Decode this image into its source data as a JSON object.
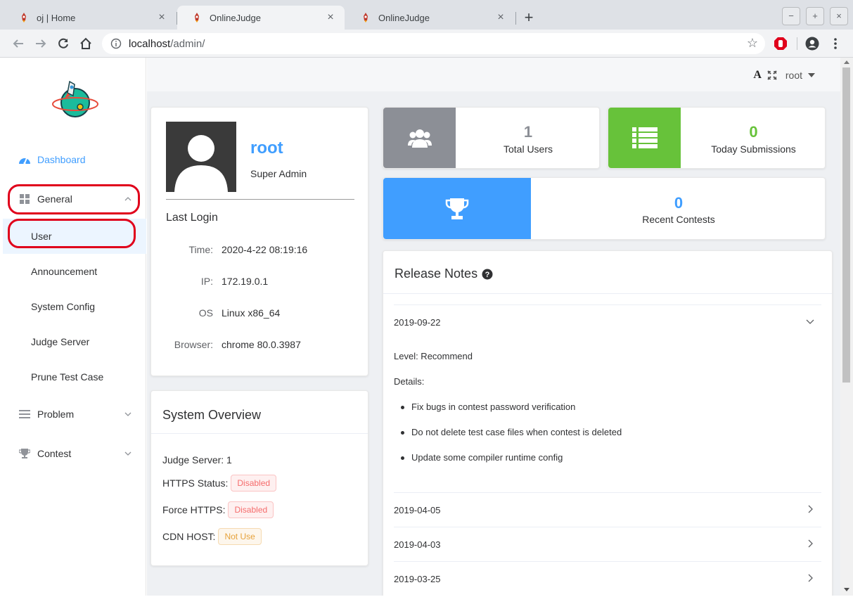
{
  "browser": {
    "tabs": [
      {
        "title": "oj | Home",
        "active": false
      },
      {
        "title": "OnlineJudge",
        "active": true
      },
      {
        "title": "OnlineJudge",
        "active": false
      }
    ],
    "address": {
      "host": "localhost",
      "path": "/admin/"
    },
    "icons": [
      "back-icon",
      "forward-icon",
      "reload-icon",
      "home-icon",
      "info-icon",
      "bookmark-star-icon",
      "adblock-icon",
      "profile-icon",
      "more-menu-icon"
    ]
  },
  "sidebar": {
    "dashboard": "Dashboard",
    "general": "General",
    "general_items": [
      "User",
      "Announcement",
      "System Config",
      "Judge Server",
      "Prune Test Case"
    ],
    "problem": "Problem",
    "contest": "Contest"
  },
  "header": {
    "username": "root"
  },
  "profile": {
    "name": "root",
    "role": "Super Admin",
    "last_login_title": "Last Login",
    "rows": [
      {
        "key": "Time:",
        "value": "2020-4-22 08:19:16"
      },
      {
        "key": "IP:",
        "value": "172.19.0.1"
      },
      {
        "key": "OS",
        "value": "Linux x86_64"
      },
      {
        "key": "Browser:",
        "value": "chrome 80.0.3987"
      }
    ]
  },
  "system_overview": {
    "title": "System Overview",
    "judge_server": "Judge Server: 1",
    "https_label": "HTTPS Status:",
    "https_value": "Disabled",
    "force_label": "Force HTTPS:",
    "force_value": "Disabled",
    "cdn_label": "CDN HOST:",
    "cdn_value": "Not Use"
  },
  "stats": [
    {
      "value": "1",
      "label": "Total Users",
      "color": "#8c8f96",
      "icon": "users-icon"
    },
    {
      "value": "0",
      "label": "Today Submissions",
      "color": "#67c23a",
      "icon": "list-icon"
    },
    {
      "value": "0",
      "label": "Recent Contests",
      "color": "#409eff",
      "icon": "trophy-icon"
    }
  ],
  "release_notes": {
    "title": "Release Notes",
    "expanded": {
      "date": "2019-09-22",
      "level": "Level: Recommend",
      "details_label": "Details:",
      "items": [
        "Fix bugs in contest password verification",
        "Do not delete test case files when contest is deleted",
        "Update some compiler runtime config"
      ]
    },
    "collapsed": [
      "2019-04-05",
      "2019-04-03",
      "2019-03-25"
    ]
  },
  "colors": {
    "accent": "#409eff",
    "success": "#67c23a",
    "danger": "#f56c6c",
    "warning": "#e6a23c",
    "highlight": "#e0001b"
  }
}
